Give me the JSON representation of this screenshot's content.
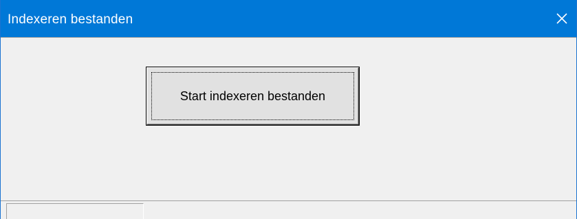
{
  "window": {
    "title": "Indexeren bestanden",
    "close_icon": "close-icon",
    "titlebar_color": "#0078d7"
  },
  "main": {
    "start_button_label": "Start indexeren bestanden"
  }
}
